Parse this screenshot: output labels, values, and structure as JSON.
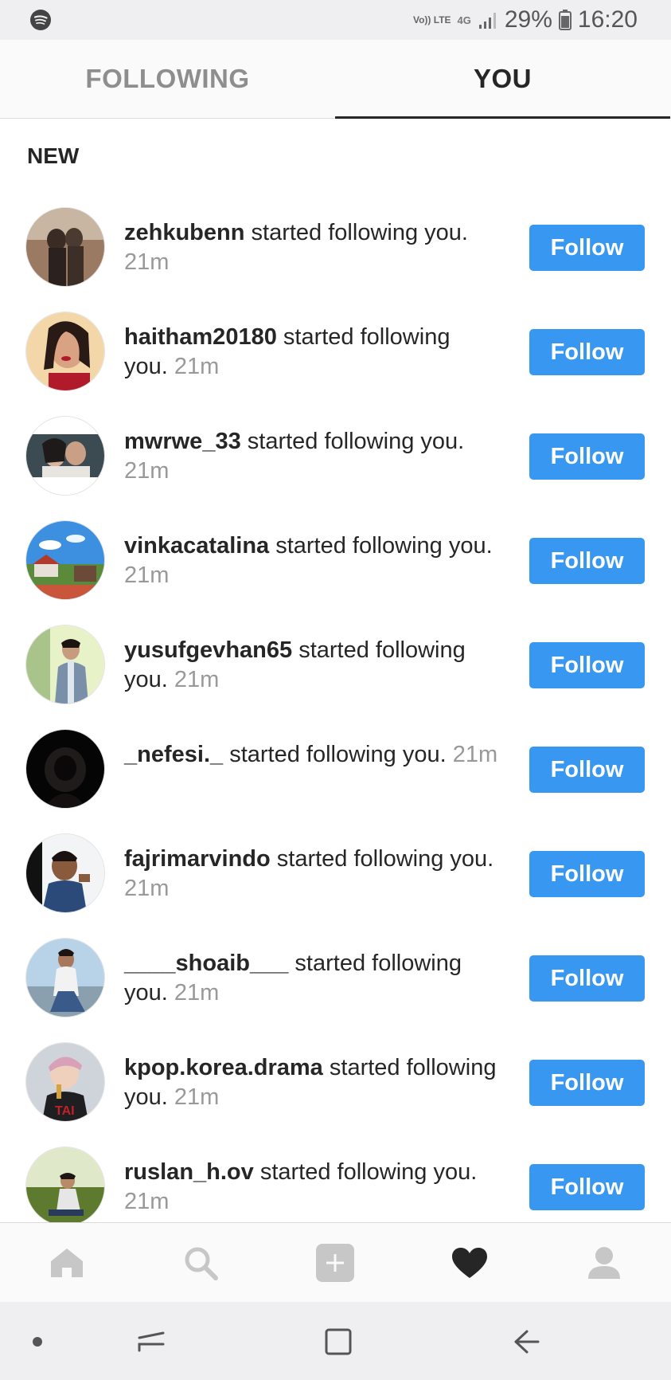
{
  "status_bar": {
    "volte": "Vo)) LTE",
    "network": "4G",
    "battery_percent": "29%",
    "time": "16:20",
    "app_icon": "spotify-icon"
  },
  "tabs": [
    {
      "label": "FOLLOWING",
      "active": false
    },
    {
      "label": "YOU",
      "active": true
    }
  ],
  "section": {
    "title": "NEW"
  },
  "notifications": [
    {
      "username": "zehkubenn",
      "action": "started following you.",
      "time": "21m",
      "button": "Follow"
    },
    {
      "username": "haitham20180",
      "action": "started following you.",
      "time": "21m",
      "button": "Follow"
    },
    {
      "username": "mwrwe_33",
      "action": "started following you.",
      "time": "21m",
      "button": "Follow"
    },
    {
      "username": "vinkacatalina",
      "action": "started following you.",
      "time": "21m",
      "button": "Follow"
    },
    {
      "username": "yusufgevhan65",
      "action": "started following you.",
      "time": "21m",
      "button": "Follow"
    },
    {
      "username": "_nefesi._",
      "action": "started following you.",
      "time": "21m",
      "button": "Follow"
    },
    {
      "username": "fajrimarvindo",
      "action": "started following you.",
      "time": "21m",
      "button": "Follow"
    },
    {
      "username": "____shoaib___",
      "action": "started following you.",
      "time": "21m",
      "button": "Follow"
    },
    {
      "username": "kpop.korea.drama",
      "action": "started following you.",
      "time": "21m",
      "button": "Follow"
    },
    {
      "username": "ruslan_h.ov",
      "action": "started following you.",
      "time": "21m",
      "button": "Follow"
    }
  ],
  "bottom_nav": [
    {
      "icon": "home-icon",
      "active": false
    },
    {
      "icon": "search-icon",
      "active": false
    },
    {
      "icon": "add-post-icon",
      "active": false
    },
    {
      "icon": "heart-icon",
      "active": true
    },
    {
      "icon": "profile-icon",
      "active": false
    }
  ],
  "system_nav": [
    "dot-icon",
    "recent-apps-icon",
    "home-square-icon",
    "back-icon"
  ],
  "colors": {
    "follow_button": "#3897f0",
    "text": "#262626",
    "muted": "#999999"
  }
}
